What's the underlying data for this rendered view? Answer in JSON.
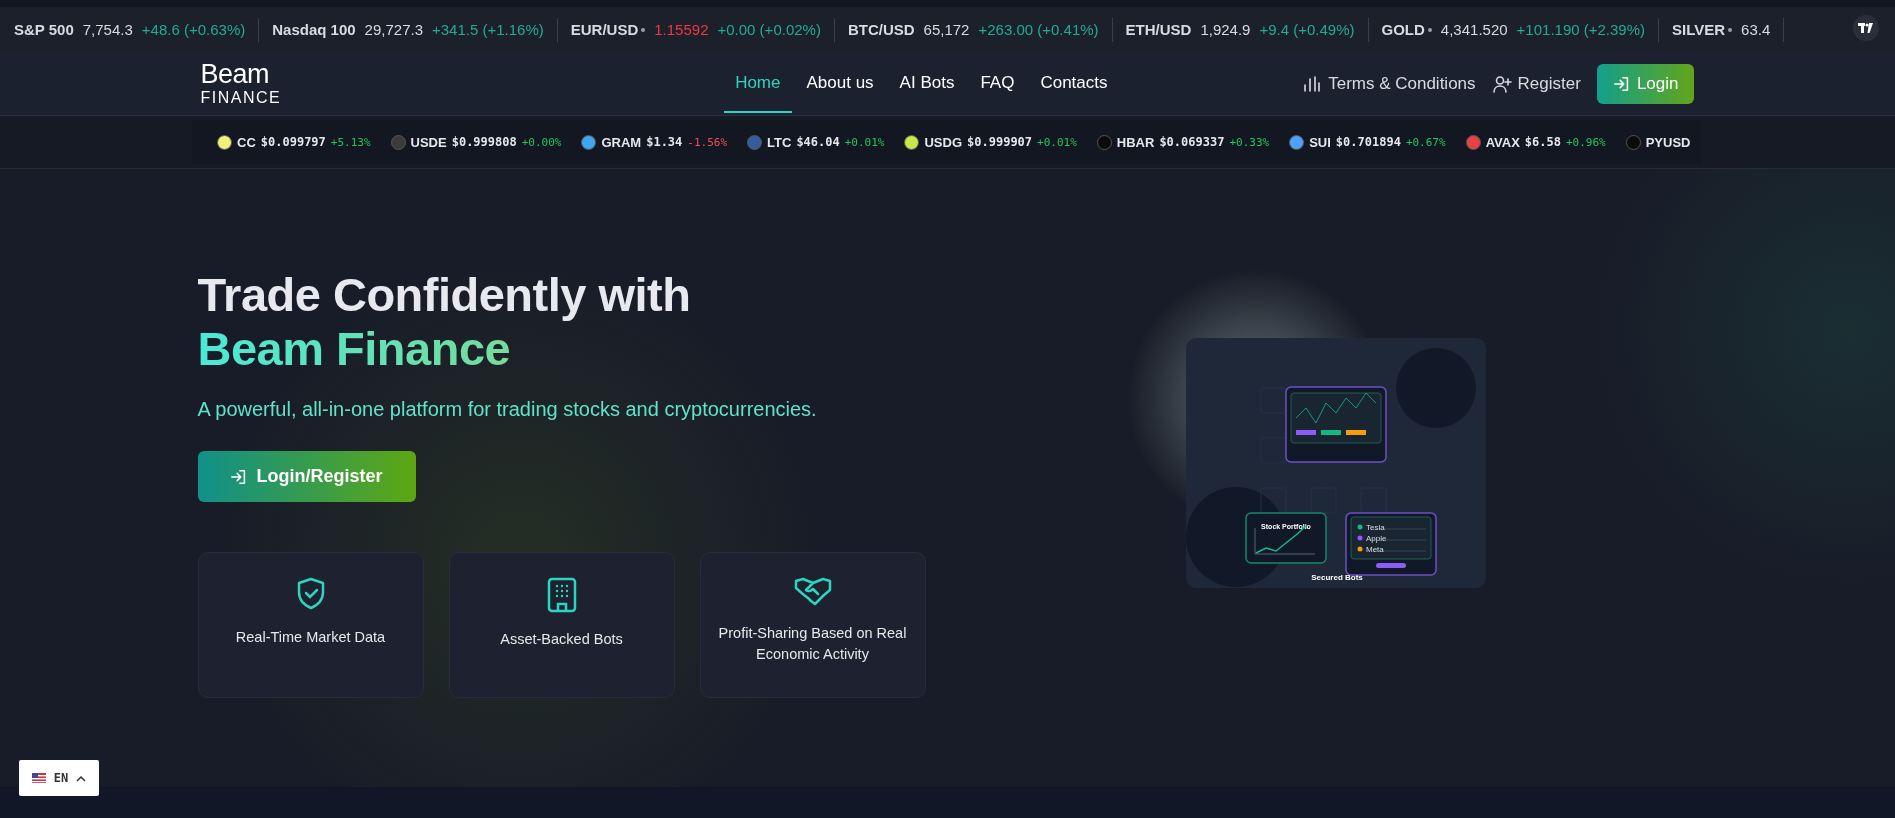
{
  "market_ticker": [
    {
      "name": "S&P 500",
      "dot": false,
      "price": "7,754.3",
      "price_down": false,
      "change": "+48.6 (+0.63%)"
    },
    {
      "name": "Nasdaq 100",
      "dot": false,
      "price": "29,727.3",
      "price_down": false,
      "change": "+341.5 (+1.16%)"
    },
    {
      "name": "EUR/USD",
      "dot": true,
      "price": "1.15592",
      "price_down": true,
      "change": "+0.00 (+0.02%)"
    },
    {
      "name": "BTC/USD",
      "dot": false,
      "price": "65,172",
      "price_down": false,
      "change": "+263.00 (+0.41%)"
    },
    {
      "name": "ETH/USD",
      "dot": false,
      "price": "1,924.9",
      "price_down": false,
      "change": "+9.4 (+0.49%)"
    },
    {
      "name": "GOLD",
      "dot": true,
      "price": "4,341.520",
      "price_down": false,
      "change": "+101.190 (+2.39%)"
    },
    {
      "name": "SILVER",
      "dot": true,
      "price": "63.4",
      "price_down": false
    }
  ],
  "logo": {
    "name": "Beam",
    "tagline": "FINANCE"
  },
  "nav": [
    {
      "label": "Home",
      "selected": true
    },
    {
      "label": "About us",
      "selected": false
    },
    {
      "label": "AI Bots",
      "selected": false
    },
    {
      "label": "FAQ",
      "selected": false
    },
    {
      "label": "Contacts",
      "selected": false
    }
  ],
  "header_actions": {
    "terms": "Terms & Conditions",
    "register": "Register",
    "login": "Login"
  },
  "crypto_ticker": [
    {
      "symbol": "CC",
      "price": "$0.099797",
      "change": "+5.13%",
      "down": false,
      "color": "#eef27a"
    },
    {
      "symbol": "USDE",
      "price": "$0.999808",
      "change": "+0.00%",
      "down": false,
      "color": "#3b3b3b"
    },
    {
      "symbol": "GRAM",
      "price": "$1.34",
      "change": "-1.56%",
      "down": true,
      "color": "#3ea6f2"
    },
    {
      "symbol": "LTC",
      "price": "$46.04",
      "change": "+0.01%",
      "down": false,
      "color": "#345d9d"
    },
    {
      "symbol": "USDG",
      "price": "$0.999907",
      "change": "+0.01%",
      "down": false,
      "color": "#c6e84a"
    },
    {
      "symbol": "HBAR",
      "price": "$0.069337",
      "change": "+0.33%",
      "down": false,
      "color": "#0b0b0b"
    },
    {
      "symbol": "SUI",
      "price": "$0.701894",
      "change": "+0.67%",
      "down": false,
      "color": "#4da2ff"
    },
    {
      "symbol": "AVAX",
      "price": "$6.58",
      "change": "+0.96%",
      "down": false,
      "color": "#e84142"
    },
    {
      "symbol": "PYUSD",
      "color": "#0b0b0b"
    }
  ],
  "hero": {
    "title": "Trade Confidently with",
    "title_highlight": "Beam Finance",
    "subtitle": "A powerful, all-in-one platform for trading stocks and cryptocurrencies.",
    "cta": "Login/Register"
  },
  "features": [
    {
      "kind": "shield",
      "label": "Real-Time Market Data"
    },
    {
      "kind": "building",
      "label": "Asset-Backed Bots"
    },
    {
      "kind": "handshake",
      "label": "Profit-Sharing Based on Real Economic Activity"
    }
  ],
  "illustration": {
    "portfolio_title": "Stock Portfolio",
    "holdings": [
      {
        "name": "Tesla",
        "color": "#10b981"
      },
      {
        "name": "Apple",
        "color": "#8b5cf6"
      },
      {
        "name": "Meta",
        "color": "#f59e0b"
      }
    ],
    "caption": "Secured Bots"
  },
  "language": {
    "code": "EN"
  }
}
